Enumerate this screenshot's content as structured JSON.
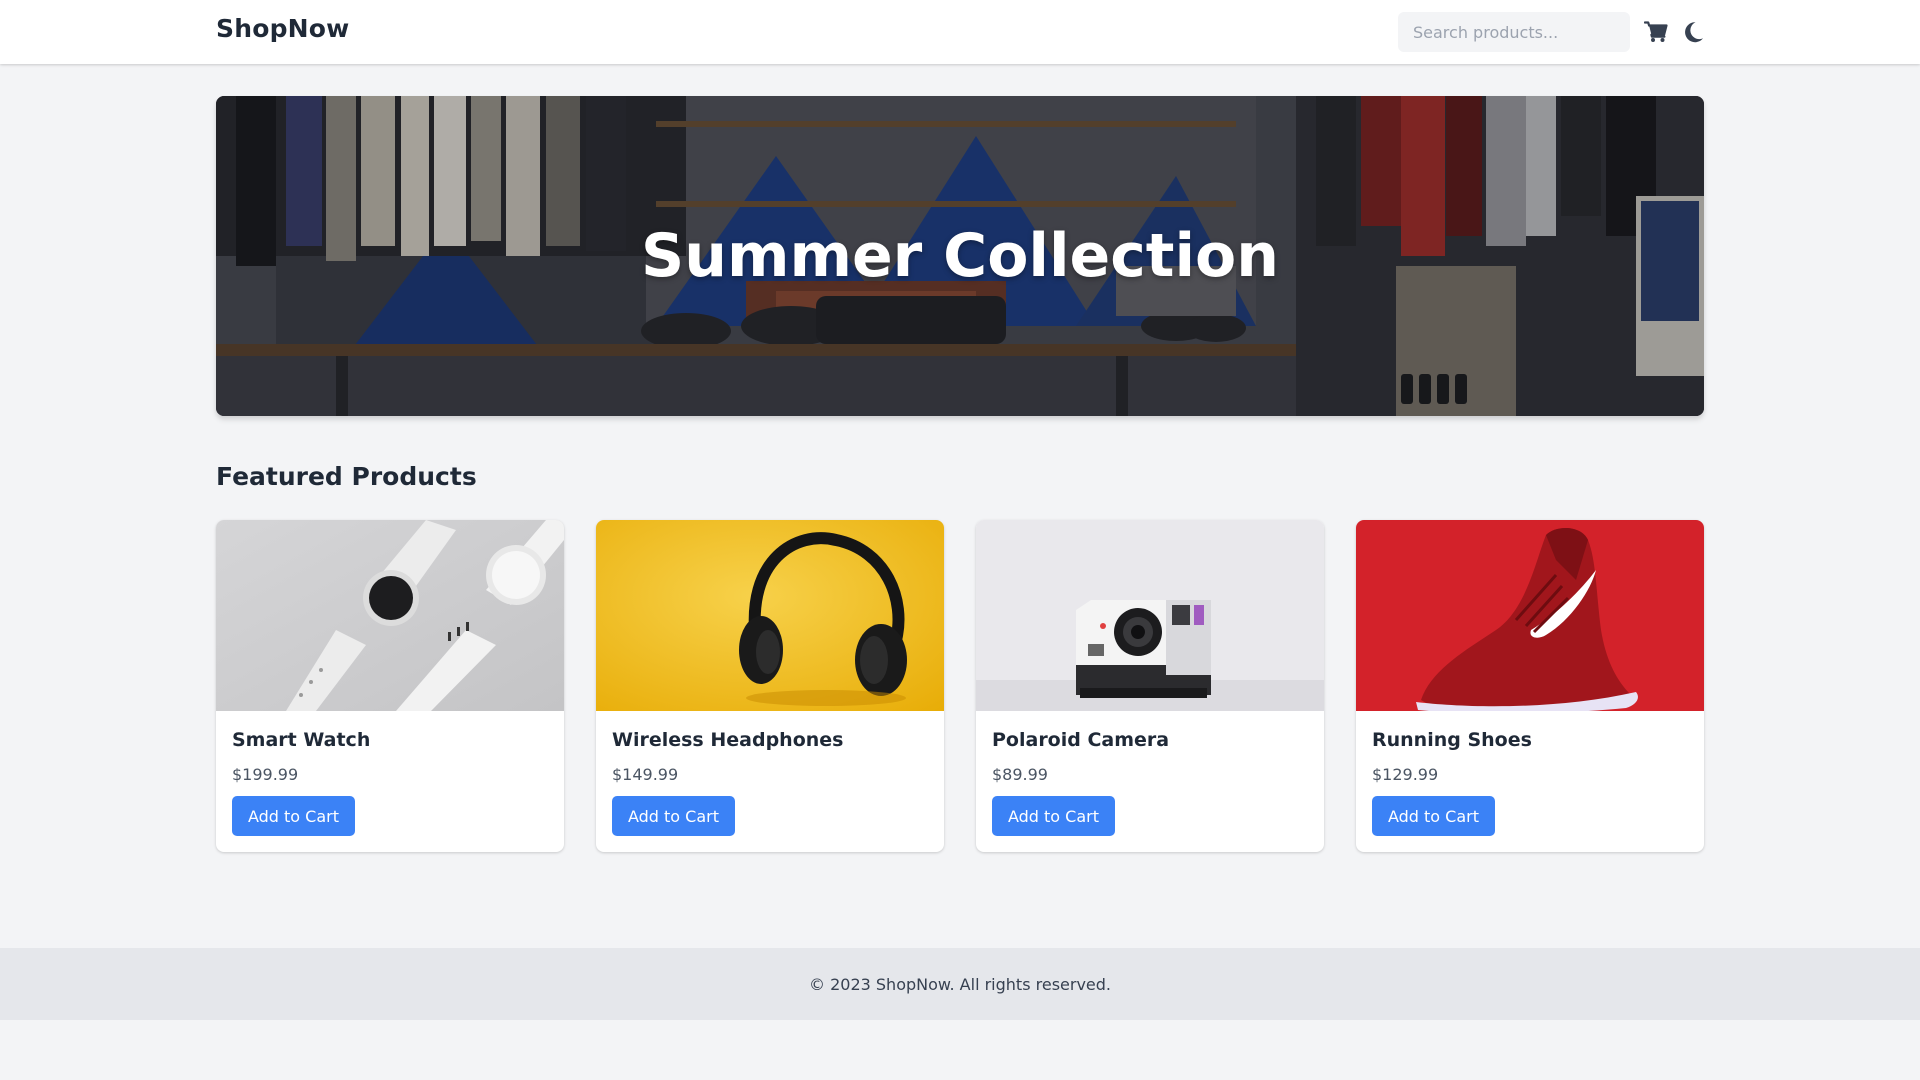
{
  "header": {
    "brand": "ShopNow",
    "search_placeholder": "Search products...",
    "cart_icon": "cart-icon",
    "theme_icon": "moon-icon"
  },
  "hero": {
    "title": "Summer Collection"
  },
  "featured": {
    "title": "Featured Products",
    "products": [
      {
        "name": "Smart Watch",
        "price": "$199.99",
        "button": "Add to Cart"
      },
      {
        "name": "Wireless Headphones",
        "price": "$149.99",
        "button": "Add to Cart"
      },
      {
        "name": "Polaroid Camera",
        "price": "$89.99",
        "button": "Add to Cart"
      },
      {
        "name": "Running Shoes",
        "price": "$129.99",
        "button": "Add to Cart"
      }
    ]
  },
  "footer": {
    "text": "© 2023 ShopNow. All rights reserved."
  },
  "colors": {
    "accent": "#3b82f6",
    "page_bg": "#f3f4f6",
    "footer_bg": "#e5e7eb",
    "text": "#1f2937"
  }
}
